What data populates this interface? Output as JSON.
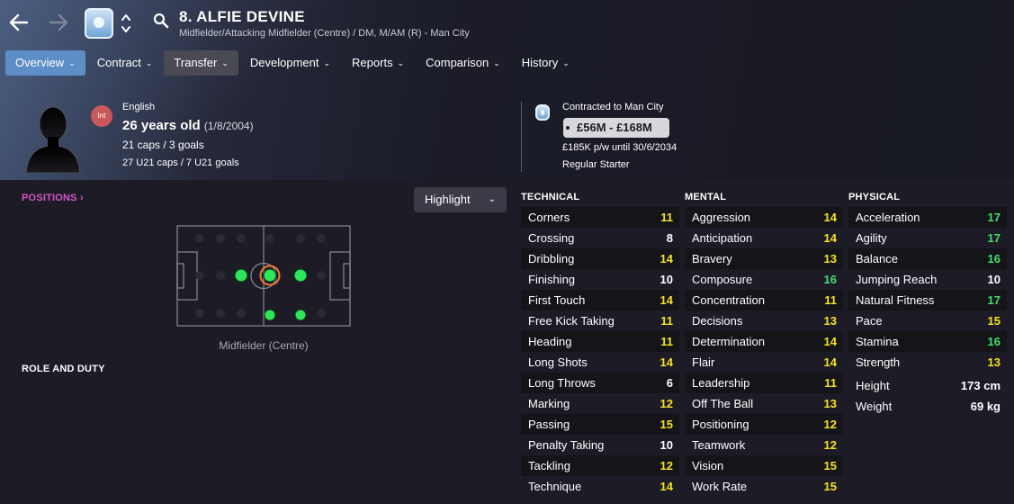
{
  "header": {
    "title": "8. ALFIE DEVINE",
    "subtitle": "Midfielder/Attacking Midfielder (Centre) / DM, M/AM (R) - Man City"
  },
  "nav": {
    "back_icon": "arrow-left-icon",
    "forward_icon": "arrow-right-icon",
    "search_icon": "magnifier-icon"
  },
  "menu": [
    {
      "label": "Overview",
      "state": "active"
    },
    {
      "label": "Contract",
      "state": "normal"
    },
    {
      "label": "Transfer",
      "state": "highlighted"
    },
    {
      "label": "Development",
      "state": "normal"
    },
    {
      "label": "Reports",
      "state": "normal"
    },
    {
      "label": "Comparison",
      "state": "normal"
    },
    {
      "label": "History",
      "state": "normal"
    }
  ],
  "player": {
    "nationality": "English",
    "badge": "Int",
    "age": "26 years old",
    "dob": "(1/8/2004)",
    "caps": "21 caps / 3 goals",
    "u21": "27 U21 caps / 7 U21 goals"
  },
  "contract": {
    "club_line": "Contracted to Man City",
    "value": "£56M - £168M",
    "wage": "£185K p/w until 30/6/2034",
    "status": "Regular Starter"
  },
  "positions": {
    "label": "POSITIONS",
    "highlight": "Highlight",
    "position_name": "Midfielder (Centre)",
    "role_label": "ROLE AND DUTY"
  },
  "columns": {
    "technical": "TECHNICAL",
    "mental": "MENTAL",
    "physical": "PHYSICAL"
  },
  "technical": [
    {
      "name": "Corners",
      "value": "11"
    },
    {
      "name": "Crossing",
      "value": "8"
    },
    {
      "name": "Dribbling",
      "value": "14"
    },
    {
      "name": "Finishing",
      "value": "10"
    },
    {
      "name": "First Touch",
      "value": "14"
    },
    {
      "name": "Free Kick Taking",
      "value": "11"
    },
    {
      "name": "Heading",
      "value": "11"
    },
    {
      "name": "Long Shots",
      "value": "14"
    },
    {
      "name": "Long Throws",
      "value": "6"
    },
    {
      "name": "Marking",
      "value": "12"
    },
    {
      "name": "Passing",
      "value": "15"
    },
    {
      "name": "Penalty Taking",
      "value": "10"
    },
    {
      "name": "Tackling",
      "value": "12"
    },
    {
      "name": "Technique",
      "value": "14"
    }
  ],
  "mental": [
    {
      "name": "Aggression",
      "value": "14"
    },
    {
      "name": "Anticipation",
      "value": "14"
    },
    {
      "name": "Bravery",
      "value": "13"
    },
    {
      "name": "Composure",
      "value": "16"
    },
    {
      "name": "Concentration",
      "value": "11"
    },
    {
      "name": "Decisions",
      "value": "13"
    },
    {
      "name": "Determination",
      "value": "14"
    },
    {
      "name": "Flair",
      "value": "14"
    },
    {
      "name": "Leadership",
      "value": "11"
    },
    {
      "name": "Off The Ball",
      "value": "13"
    },
    {
      "name": "Positioning",
      "value": "12"
    },
    {
      "name": "Teamwork",
      "value": "12"
    },
    {
      "name": "Vision",
      "value": "15"
    },
    {
      "name": "Work Rate",
      "value": "15"
    }
  ],
  "physical": [
    {
      "name": "Acceleration",
      "value": "17"
    },
    {
      "name": "Agility",
      "value": "17"
    },
    {
      "name": "Balance",
      "value": "16"
    },
    {
      "name": "Jumping Reach",
      "value": "10"
    },
    {
      "name": "Natural Fitness",
      "value": "17"
    },
    {
      "name": "Pace",
      "value": "15"
    },
    {
      "name": "Stamina",
      "value": "16"
    },
    {
      "name": "Strength",
      "value": "13"
    }
  ],
  "physical_extra": [
    {
      "name": "Height",
      "value": "173 cm"
    },
    {
      "name": "Weight",
      "value": "69 kg"
    }
  ],
  "colors": {
    "value_white": "#ffffff",
    "value_yellow": "#f3e227",
    "value_green": "#3fe06d",
    "menu_active": "#5e8ec7",
    "positions_label": "#d456c8",
    "position_dot": "#2ee65a"
  }
}
